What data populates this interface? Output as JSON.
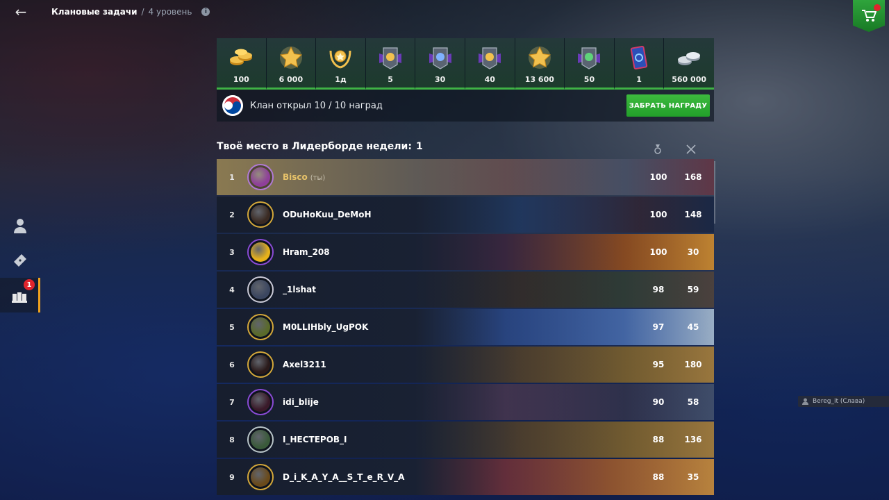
{
  "topbar": {
    "title": "Клановые задачи",
    "separator": "/",
    "level": "4 уровень",
    "info_icon": "info-icon",
    "back_icon": "arrow-left-icon",
    "shop_icon": "shopping-cart-icon"
  },
  "sidebar": {
    "items": [
      {
        "name": "profile",
        "icon": "user-silhouette-icon"
      },
      {
        "name": "tickets",
        "icon": "ticket-icon"
      },
      {
        "name": "clan-tasks",
        "icon": "clan-hands-icon",
        "badge": "1",
        "active": true
      }
    ]
  },
  "rewards": [
    {
      "icon": "gold-coins-icon",
      "amount": "100"
    },
    {
      "icon": "star-icon",
      "amount": "6 000"
    },
    {
      "icon": "gold-wreath-badge-icon",
      "amount": "1д"
    },
    {
      "icon": "gold-booster-icon",
      "amount": "5"
    },
    {
      "icon": "blue-star-booster-icon",
      "amount": "30"
    },
    {
      "icon": "gold-star-booster-icon",
      "amount": "40"
    },
    {
      "icon": "star-icon",
      "amount": "13 600"
    },
    {
      "icon": "green-star-booster-icon",
      "amount": "50"
    },
    {
      "icon": "card-icon",
      "amount": "1"
    },
    {
      "icon": "silver-coins-icon",
      "amount": "560 000"
    }
  ],
  "clan": {
    "status_text": "Клан открыл 10 / 10 наград",
    "claim_button": "ЗАБРАТЬ НАГРАДУ"
  },
  "leaderboard": {
    "title": "Твоё место в Лидерборде недели:",
    "place": "1",
    "col_score_icon": "medal-icon",
    "col_battles_icon": "crossed-swords-icon",
    "you_label": "(ты)",
    "rows": [
      {
        "rank": "1",
        "name": "Bisco",
        "score": "100",
        "battles": "168",
        "self": true,
        "ring": "#b07ad6",
        "inner": "#8f3f9a",
        "art": "night"
      },
      {
        "rank": "2",
        "name": "ODuHoKuu_DeMoH",
        "score": "100",
        "battles": "148",
        "self": false,
        "ring": "#d4a83a",
        "inner": "#3a2a22",
        "art": "blue"
      },
      {
        "rank": "3",
        "name": "Hram_208",
        "score": "100",
        "battles": "30",
        "self": false,
        "ring": "#8a4bd6",
        "inner": "#e8b21a",
        "art": "fire"
      },
      {
        "rank": "4",
        "name": "_1lshat",
        "score": "98",
        "battles": "59",
        "self": false,
        "ring": "#c9c9d6",
        "inner": "#3b4660",
        "art": "dark"
      },
      {
        "rank": "5",
        "name": "M0LLIHbly_UgPOK",
        "score": "97",
        "battles": "45",
        "self": false,
        "ring": "#d4a83a",
        "inner": "#5a6a2a",
        "art": "newyear"
      },
      {
        "rank": "6",
        "name": "Axel3211",
        "score": "95",
        "battles": "180",
        "self": false,
        "ring": "#d4a83a",
        "inner": "#2a1a1a",
        "art": "gold"
      },
      {
        "rank": "7",
        "name": "idi_blije",
        "score": "90",
        "battles": "58",
        "self": false,
        "ring": "#8a4bd6",
        "inner": "#3a1a2a",
        "art": "anime"
      },
      {
        "rank": "8",
        "name": "I_НЕСТЕРОВ_I",
        "score": "88",
        "battles": "136",
        "self": false,
        "ring": "#b8c4c8",
        "inner": "#3a5a3a",
        "art": "gold"
      },
      {
        "rank": "9",
        "name": "D_i_K_A_Y_A__S_T_e_R_V_A",
        "score": "88",
        "battles": "35",
        "self": false,
        "ring": "#d4a83a",
        "inner": "#6a4a1a",
        "art": "sunset"
      }
    ]
  },
  "user_tag": "Bereg_it (Слава)",
  "colors": {
    "accent_green": "#3fb345",
    "active_orange": "#f0a21d",
    "badge_red": "#e0242c"
  }
}
